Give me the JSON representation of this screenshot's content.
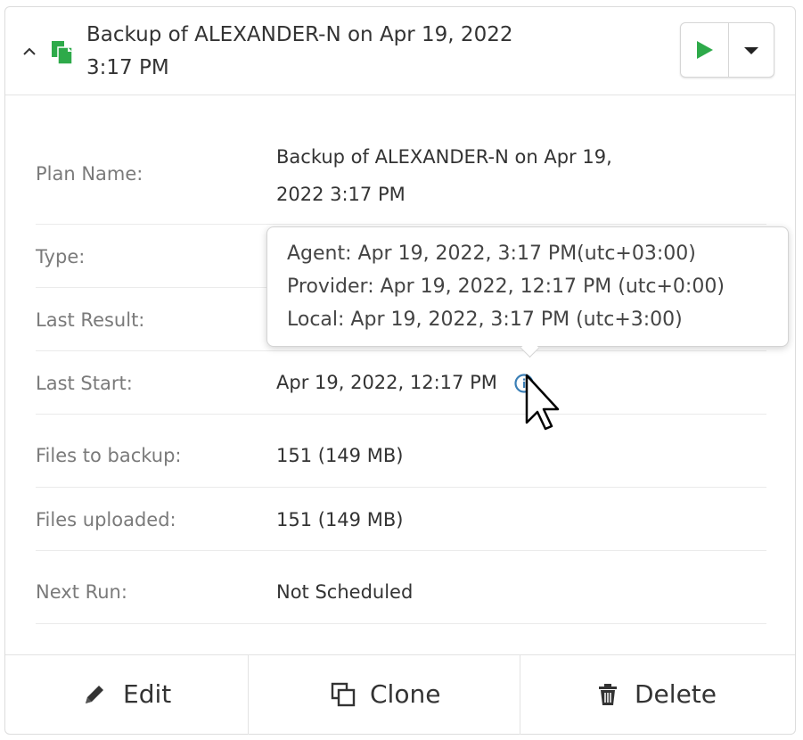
{
  "header": {
    "title_line1": "Backup of ALEXANDER-N on Apr 19, 2022",
    "title_line2": "3:17 PM"
  },
  "details": {
    "plan_name": {
      "label": "Plan Name:",
      "value_line1": "Backup of ALEXANDER-N on Apr 19,",
      "value_line2": "2022 3:17 PM"
    },
    "type": {
      "label": "Type:"
    },
    "last_result": {
      "label": "Last Result:"
    },
    "last_start": {
      "label": "Last Start:",
      "value": "Apr 19, 2022, 12:17 PM"
    },
    "files_to_backup": {
      "label": "Files to backup:",
      "value": "151 (149 MB)"
    },
    "files_uploaded": {
      "label": "Files uploaded:",
      "value": "151 (149 MB)"
    },
    "next_run": {
      "label": "Next Run:",
      "value": "Not Scheduled"
    }
  },
  "tooltip": {
    "agent": "Agent: Apr 19, 2022, 3:17 PM(utc+03:00)",
    "provider": "Provider: Apr 19, 2022, 12:17 PM (utc+0:00)",
    "local": "Local: Apr 19, 2022, 3:17 PM (utc+3:00)"
  },
  "footer": {
    "edit": "Edit",
    "clone": "Clone",
    "delete": "Delete"
  },
  "icons": {
    "collapse": "chevron-up-icon",
    "plan": "file-backup-icon",
    "run": "play-icon",
    "dropdown": "caret-down-icon",
    "info": "info-icon",
    "edit": "pencil-icon",
    "clone": "copy-icon",
    "delete": "trash-icon"
  },
  "colors": {
    "accent_green": "#2eaa4a",
    "info_blue": "#3b7fb6",
    "label_gray": "#7a7a7a",
    "text": "#333333"
  }
}
